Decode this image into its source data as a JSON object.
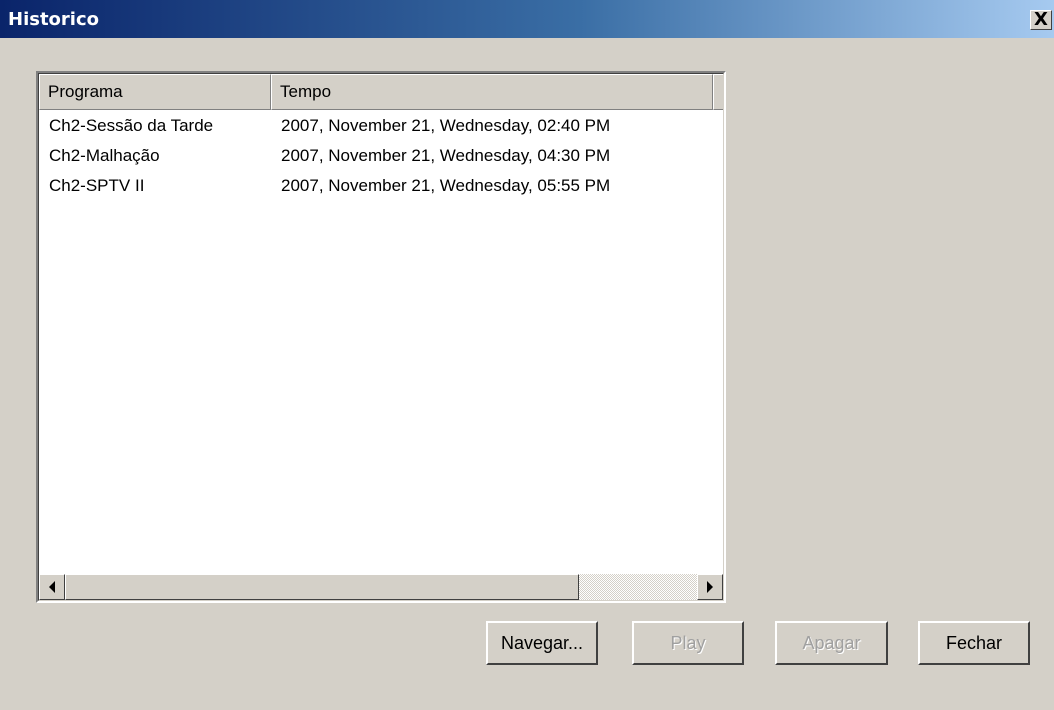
{
  "window": {
    "title": "Historico",
    "close_label": "X"
  },
  "list": {
    "columns": [
      "Programa",
      "Tempo"
    ],
    "rows": [
      {
        "programa": "Ch2-Sessão da Tarde",
        "tempo": "2007, November 21, Wednesday, 02:40 PM"
      },
      {
        "programa": "Ch2-Malhação",
        "tempo": "2007, November 21, Wednesday, 04:30 PM"
      },
      {
        "programa": "Ch2-SPTV II",
        "tempo": "2007, November 21, Wednesday, 05:55 PM"
      }
    ]
  },
  "buttons": {
    "navegar": "Navegar...",
    "play": "Play",
    "apagar": "Apagar",
    "fechar": "Fechar"
  },
  "colors": {
    "titlebar_start": "#0a246a",
    "titlebar_end": "#a6caf0",
    "face": "#d4d0c8"
  }
}
